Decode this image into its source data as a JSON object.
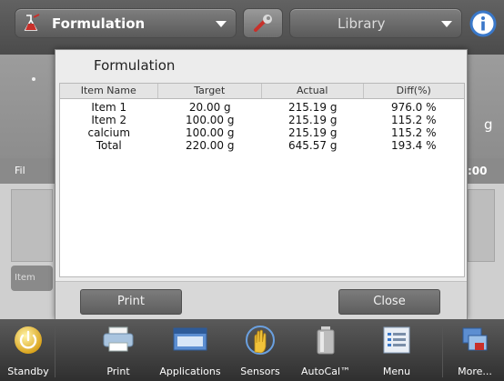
{
  "topbar": {
    "mode_label": "Formulation",
    "mode_icon": "formulation-icon",
    "library_label": "Library",
    "wrench_icon": "wrench-icon",
    "info_icon": "info-icon"
  },
  "background": {
    "unit": "g",
    "filter_label": "Fil",
    "right_value": ":00",
    "item_button": "Item"
  },
  "dialog": {
    "title": "Formulation",
    "columns": [
      "Item Name",
      "Target",
      "Actual",
      "Diff(%)"
    ],
    "rows": [
      [
        "Item 1",
        "20.00 g",
        "215.19 g",
        "976.0 %"
      ],
      [
        "Item 2",
        "100.00 g",
        "215.19 g",
        "115.2 %"
      ],
      [
        "calcium",
        "100.00 g",
        "215.19 g",
        "115.2 %"
      ],
      [
        "Total",
        "220.00 g",
        "645.57 g",
        "193.4 %"
      ]
    ],
    "print_label": "Print",
    "close_label": "Close"
  },
  "toolbar": {
    "items": [
      {
        "label": "Standby",
        "icon": "standby-icon"
      },
      {
        "label": "Print",
        "icon": "printer-icon"
      },
      {
        "label": "Applications",
        "icon": "applications-icon"
      },
      {
        "label": "Sensors",
        "icon": "sensors-icon"
      },
      {
        "label": "AutoCal™",
        "icon": "autocal-icon"
      },
      {
        "label": "Menu",
        "icon": "menu-icon"
      },
      {
        "label": "More...",
        "icon": "more-icon"
      }
    ]
  },
  "colors": {
    "accent_red": "#c8302a",
    "info_blue": "#3a78c9",
    "dialog_bg": "#ececec"
  }
}
